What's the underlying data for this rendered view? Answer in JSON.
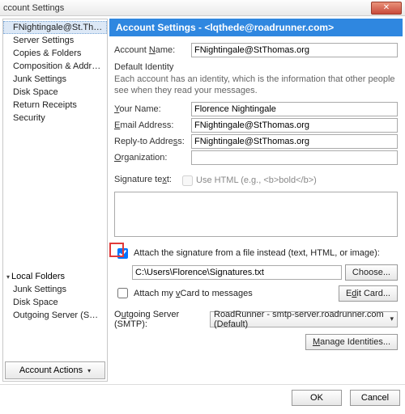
{
  "window": {
    "title": "ccount Settings"
  },
  "sidebar": {
    "account_items": [
      "FNightingale@St.Thomas.org",
      "Server Settings",
      "Copies & Folders",
      "Composition & Addressing",
      "Junk Settings",
      "Disk Space",
      "Return Receipts",
      "Security"
    ],
    "local_group": "Local Folders",
    "local_items": [
      "Junk Settings",
      "Disk Space",
      "Outgoing Server (SMTP)"
    ],
    "account_actions": "Account Actions"
  },
  "header": "Account Settings - <lqthede@roadrunner.com>",
  "labels": {
    "account_name": "Account Name:",
    "default_identity": "Default Identity",
    "identity_desc": "Each account has an identity, which is the information that other people see when they read your messages.",
    "your_name": "Your Name:",
    "email": "Email Address:",
    "reply_to": "Reply-to Address:",
    "organization": "Organization:",
    "signature_text": "Signature text:",
    "use_html": "Use HTML (e.g., <b>bold</b>)",
    "attach_file": "Attach the signature from a file instead (text, HTML, or image):",
    "choose": "Choose...",
    "attach_vcard": "Attach my vCard to messages",
    "edit_card": "Edit Card...",
    "smtp": "Outgoing Server (SMTP):",
    "manage_identities": "Manage Identities...",
    "ok": "OK",
    "cancel": "Cancel"
  },
  "values": {
    "account_name": "FNightingale@StThomas.org",
    "your_name": "Florence Nightingale",
    "email": "FNightingale@StThomas.org",
    "reply_to": "FNightingale@StThomas.org",
    "organization": "",
    "sig_path": "C:\\Users\\Florence\\Signatures.txt",
    "smtp_value": "RoadRunner - smtp-server.roadrunner.com (Default)"
  }
}
